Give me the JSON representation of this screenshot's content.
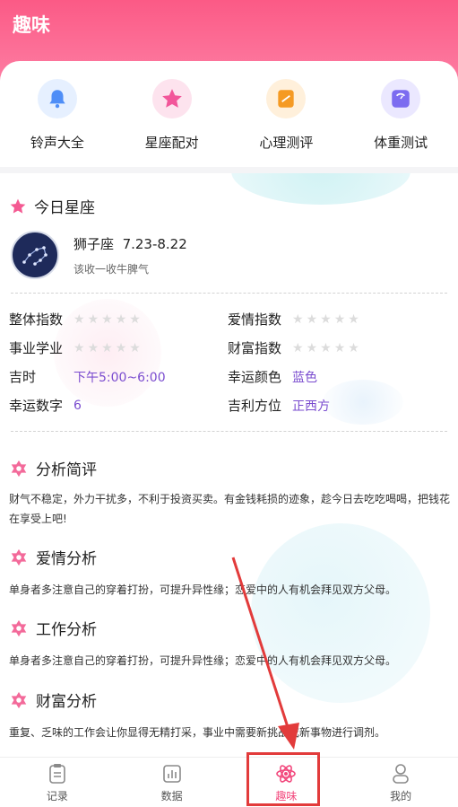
{
  "header": {
    "title": "趣味"
  },
  "quick_links": [
    {
      "label": "铃声大全",
      "icon": "bell-icon",
      "color": "#4f8ef7"
    },
    {
      "label": "星座配对",
      "icon": "star-icon",
      "color": "#f2569a"
    },
    {
      "label": "心理测评",
      "icon": "notebook-icon",
      "color": "#f59a23"
    },
    {
      "label": "体重测试",
      "icon": "scale-icon",
      "color": "#7c6cf0"
    }
  ],
  "today": {
    "title": "今日星座",
    "zodiac_name": "狮子座",
    "zodiac_dates": "7.23-8.22",
    "description": "该收一收牛脾气",
    "metrics": {
      "overall": {
        "label": "整体指数"
      },
      "love": {
        "label": "爱情指数"
      },
      "career": {
        "label": "事业学业"
      },
      "wealth": {
        "label": "财富指数"
      },
      "lucky_time": {
        "label": "吉时",
        "value": "下午5:00~6:00"
      },
      "lucky_color": {
        "label": "幸运颜色",
        "value": "蓝色"
      },
      "lucky_number": {
        "label": "幸运数字",
        "value": "6"
      },
      "lucky_direction": {
        "label": "吉利方位",
        "value": "正西方"
      }
    }
  },
  "sections": [
    {
      "title": "分析简评",
      "text": "财气不稳定，外力干扰多，不利于投资买卖。有金钱耗损的迹象，趁今日去吃吃喝喝，把钱花在享受上吧!"
    },
    {
      "title": "爱情分析",
      "text": "单身者多注意自己的穿着打扮，可提升异性缘；恋爱中的人有机会拜见双方父母。"
    },
    {
      "title": "工作分析",
      "text": "单身者多注意自己的穿着打扮，可提升异性缘；恋爱中的人有机会拜见双方父母。"
    },
    {
      "title": "财富分析",
      "text": "重复、乏味的工作会让你显得无精打采，事业中需要新挑战或新事物进行调剂。"
    }
  ],
  "tabbar": {
    "items": [
      {
        "label": "记录",
        "icon": "record-icon"
      },
      {
        "label": "数据",
        "icon": "chart-icon"
      },
      {
        "label": "趣味",
        "icon": "atom-icon",
        "active": true
      },
      {
        "label": "我的",
        "icon": "person-icon"
      }
    ]
  },
  "colors": {
    "brand": "#f2477c",
    "accent_value": "#7a4ccf"
  }
}
